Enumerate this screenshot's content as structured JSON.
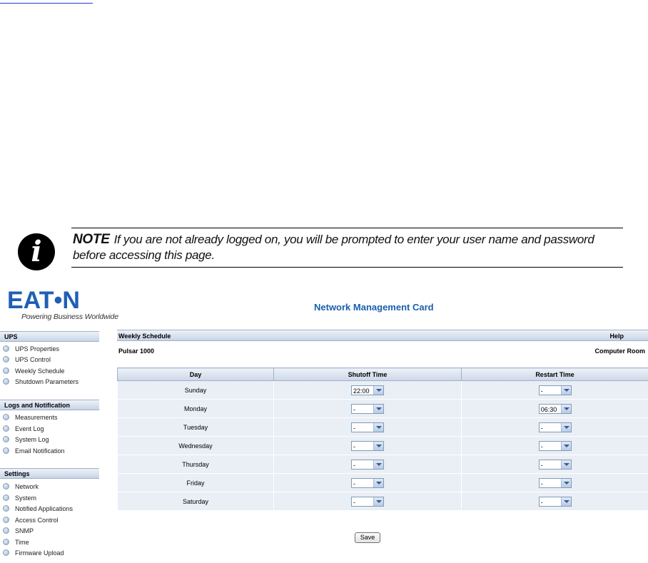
{
  "note": {
    "label": "NOTE",
    "text": "If you are not already logged on, you will be prompted to enter your user name and password before accessing this page."
  },
  "logo": {
    "main": "EAT•N",
    "tagline": "Powering Business Worldwide"
  },
  "app_title": "Network Management Card",
  "sidebar": {
    "sections": [
      {
        "title": "UPS",
        "items": [
          "UPS Properties",
          "UPS Control",
          "Weekly Schedule",
          "Shutdown Parameters"
        ]
      },
      {
        "title": "Logs and Notification",
        "items": [
          "Measurements",
          "Event Log",
          "System Log",
          "Email Notification"
        ]
      },
      {
        "title": "Settings",
        "items": [
          "Network",
          "System",
          "Notified Applications",
          "Access Control",
          "SNMP",
          "Time",
          "Firmware Upload"
        ]
      }
    ]
  },
  "page": {
    "title": "Weekly Schedule",
    "help": "Help",
    "device": "Pulsar 1000",
    "location": "Computer Room"
  },
  "table": {
    "headers": [
      "Day",
      "Shutoff Time",
      "Restart Time"
    ],
    "rows": [
      {
        "day": "Sunday",
        "shutoff": "22:00",
        "restart": "-"
      },
      {
        "day": "Monday",
        "shutoff": "-",
        "restart": "06:30"
      },
      {
        "day": "Tuesday",
        "shutoff": "-",
        "restart": "-"
      },
      {
        "day": "Wednesday",
        "shutoff": "-",
        "restart": "-"
      },
      {
        "day": "Thursday",
        "shutoff": "-",
        "restart": "-"
      },
      {
        "day": "Friday",
        "shutoff": "-",
        "restart": "-"
      },
      {
        "day": "Saturday",
        "shutoff": "-",
        "restart": "-"
      }
    ]
  },
  "save_label": "Save"
}
